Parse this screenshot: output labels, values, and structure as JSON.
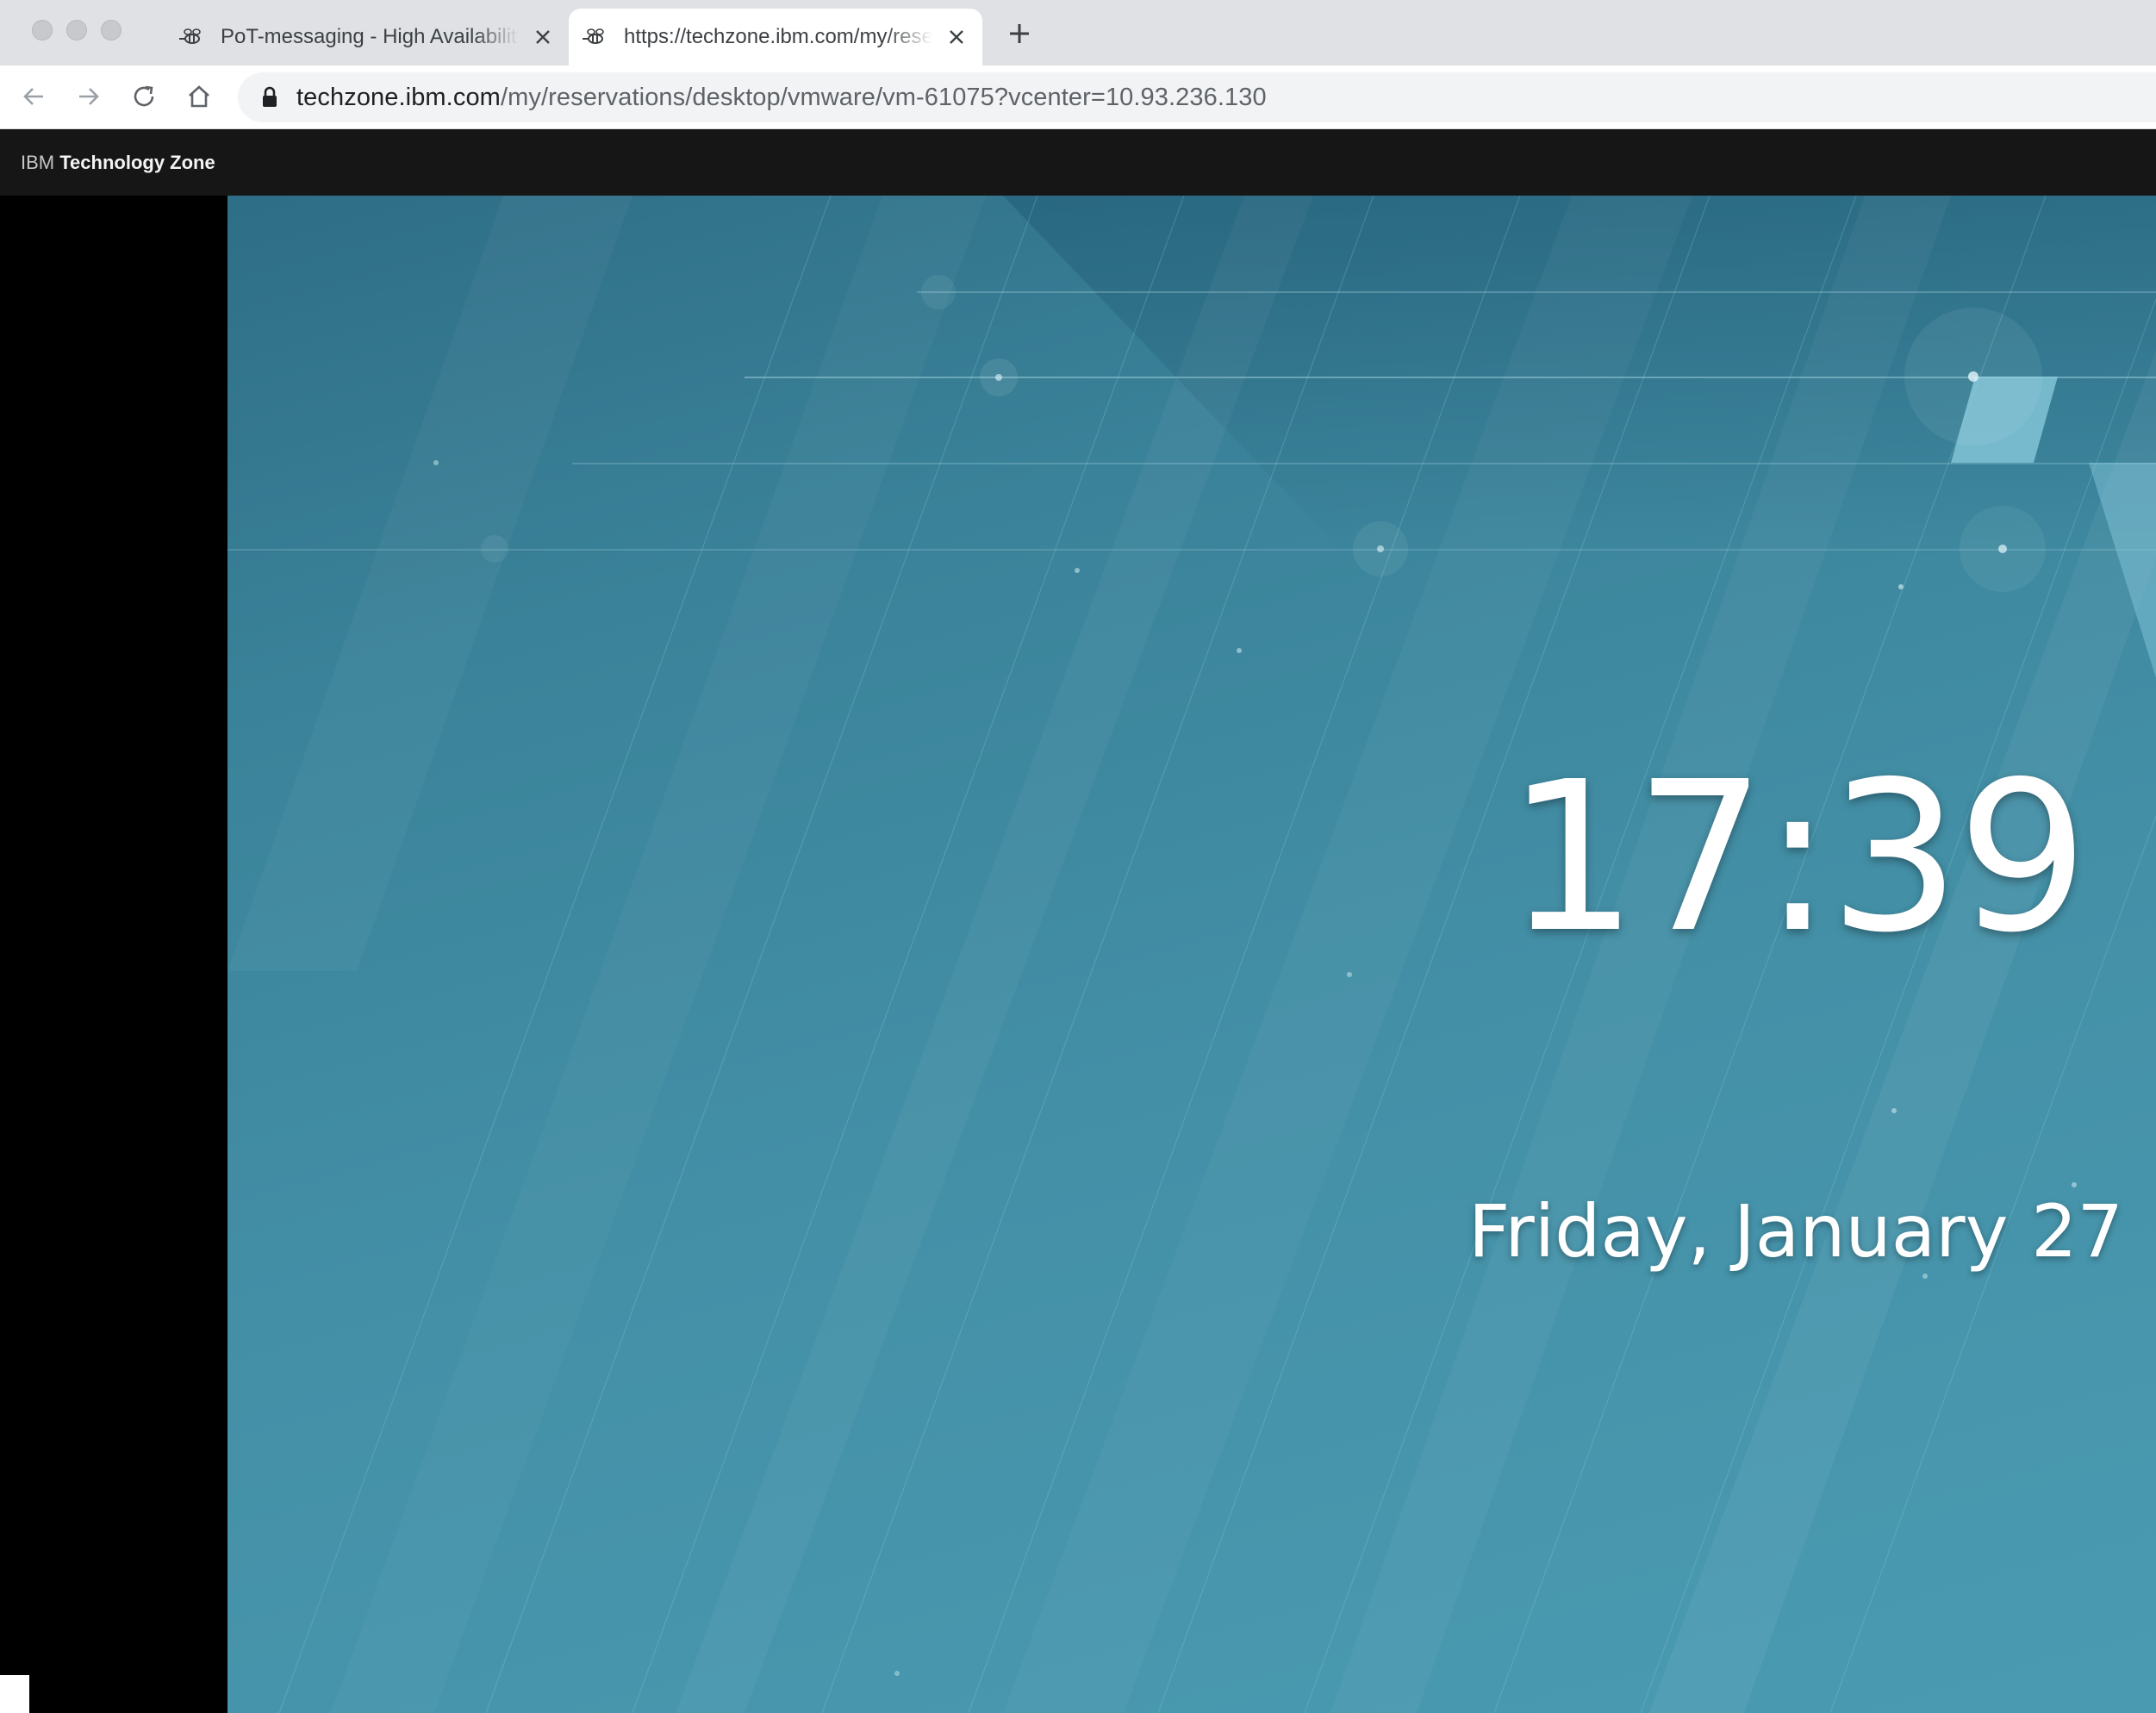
{
  "browser": {
    "tabs": [
      {
        "title": "PoT-messaging - High Availability",
        "active": false,
        "favicon": "bee-icon"
      },
      {
        "title": "https://techzone.ibm.com/my/reservations",
        "active": true,
        "favicon": "bee-icon"
      }
    ],
    "address_bar": {
      "host": "techzone.ibm.com",
      "path": "/my/reservations/desktop/vmware/vm-61075?vcenter=10.93.236.130"
    }
  },
  "site_header": {
    "brand_prefix": "IBM",
    "brand_name": "Technology Zone"
  },
  "lock_screen": {
    "time": "17:39",
    "date": "Friday, January 27"
  },
  "colors": {
    "tab_strip": "#dfe1e5",
    "header_bg": "#161616",
    "desktop_accent": "#438fa6"
  }
}
